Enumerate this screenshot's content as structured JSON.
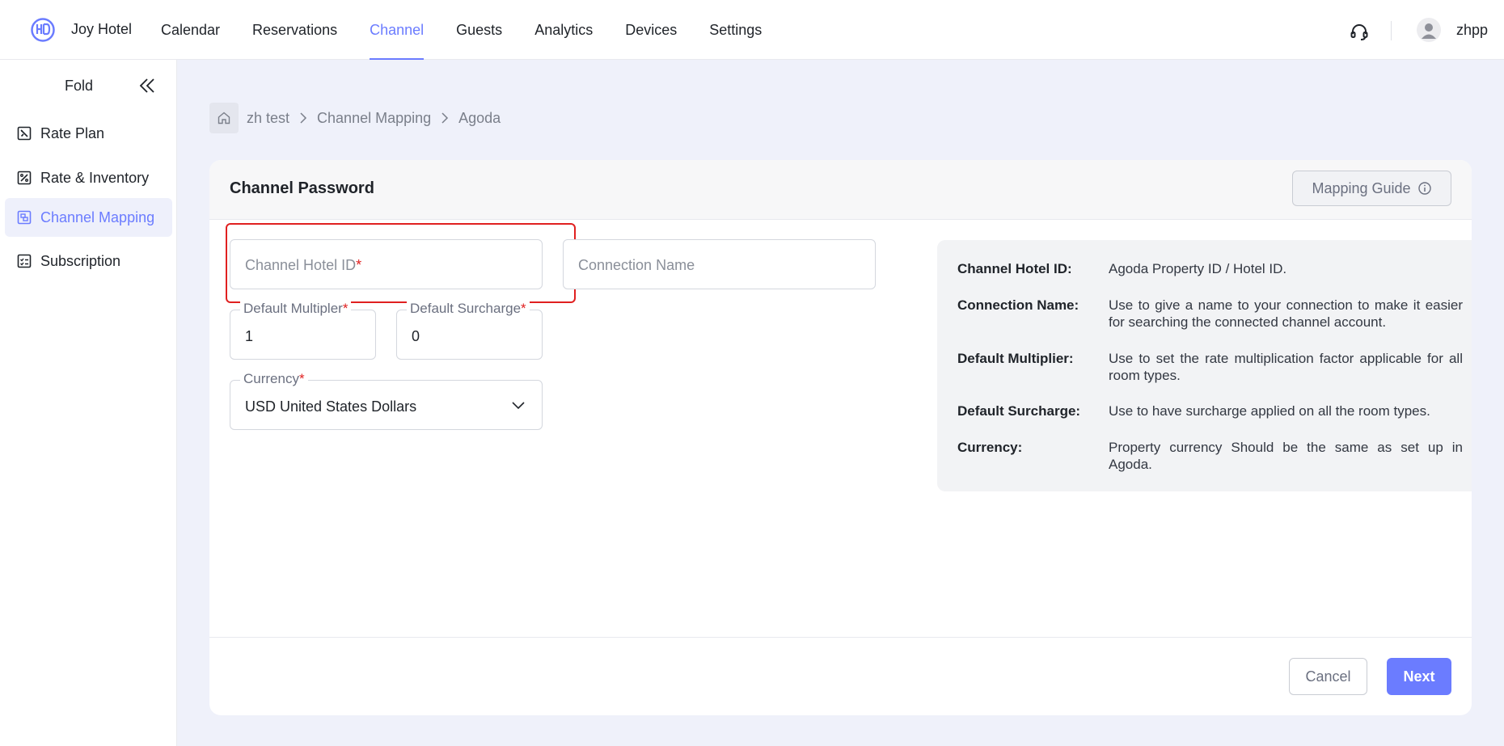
{
  "brand": {
    "name": "Joy Hotel"
  },
  "nav": {
    "items": [
      {
        "label": "Calendar"
      },
      {
        "label": "Reservations"
      },
      {
        "label": "Channel",
        "active": true
      },
      {
        "label": "Guests"
      },
      {
        "label": "Analytics"
      },
      {
        "label": "Devices"
      },
      {
        "label": "Settings"
      }
    ]
  },
  "user": {
    "name": "zhpp"
  },
  "sidebar": {
    "fold_label": "Fold",
    "items": [
      {
        "label": "Rate Plan",
        "icon": "rate-plan-icon"
      },
      {
        "label": "Rate & Inventory",
        "icon": "rate-inventory-icon"
      },
      {
        "label": "Channel Mapping",
        "icon": "channel-mapping-icon",
        "active": true
      },
      {
        "label": "Subscription",
        "icon": "subscription-icon"
      }
    ]
  },
  "breadcrumb": {
    "items": [
      "zh test",
      "Channel Mapping",
      "Agoda"
    ]
  },
  "card": {
    "title": "Channel Password",
    "guide_label": "Mapping Guide"
  },
  "form": {
    "hotel_id_placeholder": "Channel Hotel ID",
    "connection_name_placeholder": "Connection Name",
    "multiplier_label": "Default Multipler",
    "multiplier_value": "1",
    "surcharge_label": "Default Surcharge",
    "surcharge_value": "0",
    "currency_label": "Currency",
    "currency_value": "USD United States Dollars",
    "required_mark": "*"
  },
  "info": {
    "rows": [
      {
        "key": "Channel Hotel ID:",
        "value": "Agoda Property ID / Hotel ID."
      },
      {
        "key": "Connection Name:",
        "value": "Use to give a name to your connection to make it easier for searching the connected channel account."
      },
      {
        "key": "Default Multiplier:",
        "value": "Use to set the rate multiplication factor applicable for all room types."
      },
      {
        "key": "Default Surcharge:",
        "value": "Use to have surcharge applied on all the room types."
      },
      {
        "key": "Currency:",
        "value": "Property currency Should be the same as set up in Agoda."
      }
    ]
  },
  "footer": {
    "cancel_label": "Cancel",
    "next_label": "Next"
  },
  "colors": {
    "accent": "#6b7cff",
    "required": "#e02020",
    "main_bg": "#eff1fa"
  }
}
